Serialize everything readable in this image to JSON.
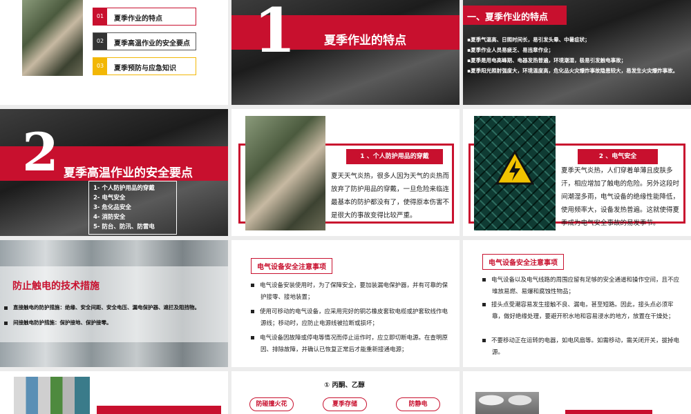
{
  "toc": {
    "items": [
      {
        "num": "01",
        "label": "夏季作业的特点"
      },
      {
        "num": "02",
        "label": "夏季高温作业的安全要点"
      },
      {
        "num": "03",
        "label": "夏季预防与应急知识"
      }
    ]
  },
  "sec1": {
    "num": "1",
    "title": "夏季作业的特点"
  },
  "features": {
    "heading": "一、夏季作业的特点",
    "lines": [
      "夏季气温高、日照时间长，易引发头晕、中暑症状；",
      "夏季作业人员易疲乏、易违章作业；",
      "夏季是用电高峰期、电器发热普遍，环境潮湿，极易引发触电事故；",
      "夏季阳光照射强度大，环境温度高，危化品火灾爆炸事故隐患较大，易发生火灾爆炸事故。"
    ]
  },
  "sec2": {
    "num": "2",
    "title": "夏季高温作业的安全要点",
    "items": [
      "1- 个人防护用品的穿戴",
      "2- 电气安全",
      "3- 危化品安全",
      "4- 消防安全",
      "5- 防台、防汛、防雷电"
    ]
  },
  "ppe": {
    "tag": "1 、个人防护用品的穿戴",
    "text": "夏天天气炎热，很多人因为天气的炎热而放弃了防护用品的穿戴，一旦危险来临连最基本的防护都没有了，使得原本伤害不是很大的事故变得比较严重。"
  },
  "elec": {
    "tag": "2 、电气安全",
    "text": "夏季天气炎热，人们穿着单薄且皮肤多汗，相应增加了触电的危险。另外这段时间潮湿多雨，电气设备的绝缘性能降低，使用频率大，设备发热普遍。这就使得夏季成为电气安全事故的易发季节。"
  },
  "anti": {
    "title": "防止触电的技术措施",
    "lines": [
      "直接触电的防护措施：绝缘、安全间距、安全电压、漏电保护器、遮拦及阻挡物。",
      "间接触电防护措施：保护接地、保护接零。"
    ]
  },
  "notes1": {
    "title": "电气设备安全注意事项",
    "items": [
      "电气设备安装使用时，为了保障安全，要加装漏电保护器，并有可靠的保护接零、接地装置；",
      "使用可移动的电气设备，应采用完好的铜芯橡皮套软电缆或护套软线作电源线；移动时，应防止电源线被拉断或损坏；",
      "电气设备因故障或停电等情况而停止运作时，应立即切断电源。在查明原因、排除故障，并确认已恢复正常后才能重新接通电源；"
    ]
  },
  "notes2": {
    "title": "电气设备安全注意事项",
    "items": [
      "电气设备以及电气线路的周围应留有足够的安全通道和操作空间，且不应堆放易燃、易爆和腐蚀性物品；",
      "接头点受潮容易发生接触不良、漏电，甚至短路。因此，接头点必须牢靠，做好绝缘处理，要避开积水地和容易浸水的地方，放置在干燥处；",
      "不要移动正在运转的电器，如电风扇等。如需移动，需关闭开关，拔掉电源。"
    ]
  },
  "chem": {
    "heading": "① 丙酮、乙醇",
    "pills": [
      "防碰撞火花",
      "夏季存储",
      "防静电"
    ]
  },
  "colors": {
    "accent": "#c8102e",
    "toc_num2": "#333333",
    "toc_num3": "#f2b705"
  },
  "icons": {
    "warning": "high-voltage-warning-icon"
  }
}
